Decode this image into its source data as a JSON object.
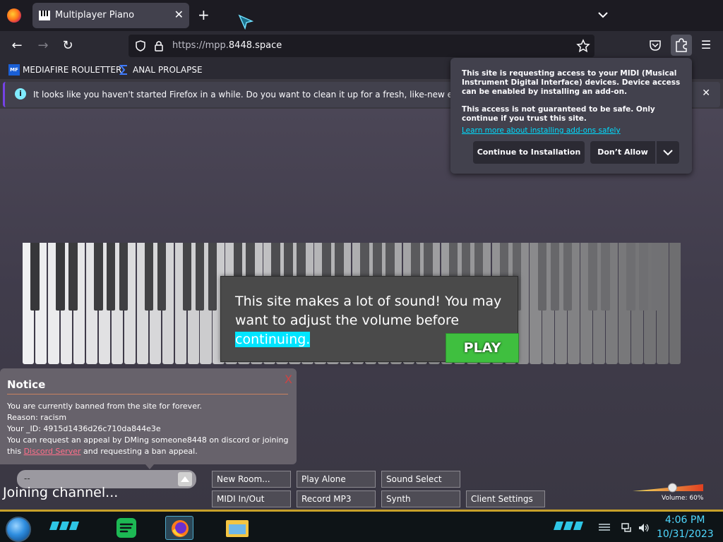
{
  "browser": {
    "tab_title": "Multiplayer Piano",
    "tab_close": "✕",
    "new_tab": "+",
    "url_prefix": "https://mpp.",
    "url_domain": "8448.space",
    "bookmarks": [
      "MEDIAFIRE ROULETTER",
      "ANAL PROLAPSE"
    ],
    "bookmark_icon_text": "MF",
    "infobar_text": "It looks like you haven't started Firefox in a while. Do you want to clean it up for a fresh, like-new experience? And",
    "infobar_close": "✕",
    "accent": "#7542e5"
  },
  "midi_popup": {
    "paragraph1": "This site is requesting access to your MIDI (Musical Instrument Digital Interface) devices. Device access can be enabled by installing an add-on.",
    "paragraph2": "This access is not guaranteed to be safe. Only continue if you trust this site.",
    "link": "Learn more about installing add-ons safely",
    "continue_button": "Continue to Installation",
    "deny_button": "Don’t Allow"
  },
  "volume_modal": {
    "text_main": "This site makes a lot of sound! You may want to adjust the volume before ",
    "text_highlight": "continuing.",
    "play_button": "PLAY"
  },
  "notice": {
    "title": "Notice",
    "close": "X",
    "line1": "You are currently banned from the site for forever.",
    "line2": "Reason: racism",
    "line3": "Your _ID: 4915d1436d26c710da844e3e",
    "line4": "You can request an appeal by DMing someone8448 on discord or joining",
    "line5_prefix": "this ",
    "line5_link": "Discord Server",
    "line5_suffix": " and requesting a ban appeal."
  },
  "room": {
    "selected": "--",
    "status": "Joining channel..."
  },
  "buttons": {
    "new_room": "New Room...",
    "play_alone": "Play Alone",
    "sound_select": "Sound Select",
    "midi_io": "MIDI In/Out",
    "record_mp3": "Record MP3",
    "synth": "Synth",
    "client_settings": "Client Settings"
  },
  "volume": {
    "label": "Volume: 60%",
    "level": 0.6
  },
  "taskbar": {
    "time": "4:06 PM",
    "date": "10/31/2023",
    "apps": [
      "spotify-icon",
      "firefox-icon",
      "file-explorer-icon"
    ],
    "accent": "#c8a12a"
  }
}
